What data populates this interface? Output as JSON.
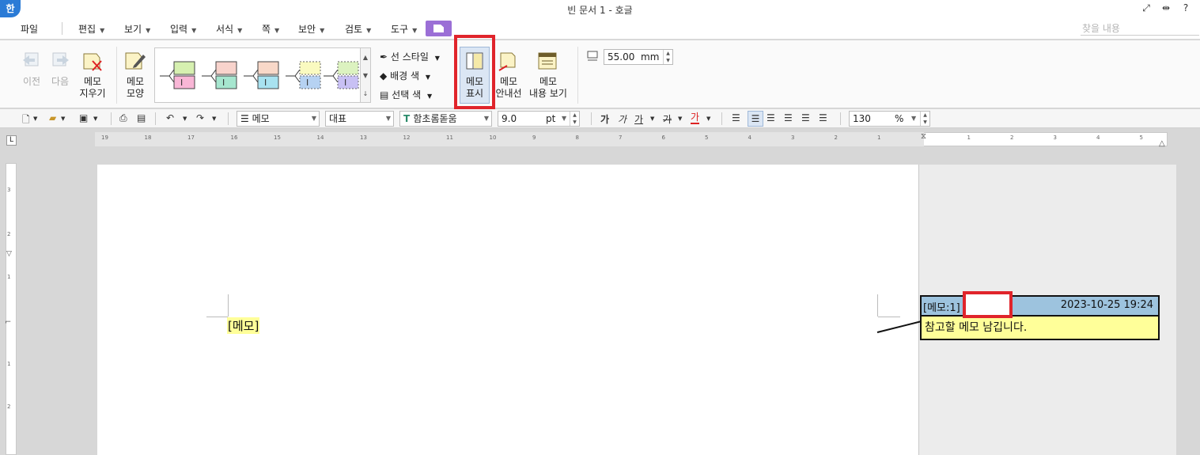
{
  "window": {
    "app_icon": "한",
    "title": "빈 문서 1 - 호글",
    "controls": [
      "⤢",
      "⇹",
      "?"
    ]
  },
  "menu": {
    "items": [
      {
        "label": "파일",
        "dropdown": false
      },
      {
        "label": "편집",
        "dropdown": true
      },
      {
        "label": "보기",
        "dropdown": true
      },
      {
        "label": "입력",
        "dropdown": true
      },
      {
        "label": "서식",
        "dropdown": true
      },
      {
        "label": "쪽",
        "dropdown": true
      },
      {
        "label": "보안",
        "dropdown": true
      },
      {
        "label": "검토",
        "dropdown": true
      },
      {
        "label": "도구",
        "dropdown": true
      }
    ],
    "search_placeholder": "찾을 내용"
  },
  "ribbon": {
    "prev": {
      "label": "이전",
      "enabled": false
    },
    "next": {
      "label": "다음",
      "enabled": false
    },
    "erase": {
      "line1": "메모",
      "line2": "지우기"
    },
    "shape": {
      "line1": "메모",
      "line2": "모양"
    },
    "gallery_styles": [
      {
        "top": "#d6f0b0",
        "bottom": "#f9b6d6"
      },
      {
        "top": "#f8d3cc",
        "bottom": "#a6e6cf"
      },
      {
        "top": "#f8d8c8",
        "bottom": "#a8e2f0"
      },
      {
        "top": "#fafac0",
        "bottom": "#b6d2f2"
      },
      {
        "top": "#dcf2c0",
        "bottom": "#c8c0f4"
      }
    ],
    "line_style": "선 스타일",
    "bg_color": "배경 색",
    "select_color": "선택 색",
    "show_memo": {
      "line1": "메모",
      "line2": "표시"
    },
    "guide_line": {
      "line1": "메모",
      "line2": "안내선"
    },
    "view_content": {
      "line1": "메모",
      "line2": "내용 보기"
    },
    "width_value": "55.00",
    "width_unit": "mm"
  },
  "format_bar": {
    "style": "메모",
    "lang": "대표",
    "font": "함초롬돋움",
    "size": "9.0",
    "size_unit": "pt",
    "char_buttons": [
      "가",
      "가",
      "가",
      "가",
      "가"
    ],
    "zoom": "130",
    "zoom_unit": "%"
  },
  "ruler": {
    "h_numbers": [
      "19",
      "18",
      "17",
      "16",
      "15",
      "14",
      "13",
      "12",
      "11",
      "10",
      "9",
      "8",
      "7",
      "6",
      "5",
      "4",
      "3",
      "2",
      "1",
      "1",
      "2",
      "3",
      "4",
      "5"
    ],
    "v_numbers": [
      "3",
      "2",
      "1",
      "1",
      "2"
    ],
    "corner": "L"
  },
  "document": {
    "memo_mark": "메모"
  },
  "memo": {
    "label": "[메모:1]",
    "datetime": "2023-10-25 19:24",
    "body": "참고할 메모 남깁니다."
  }
}
